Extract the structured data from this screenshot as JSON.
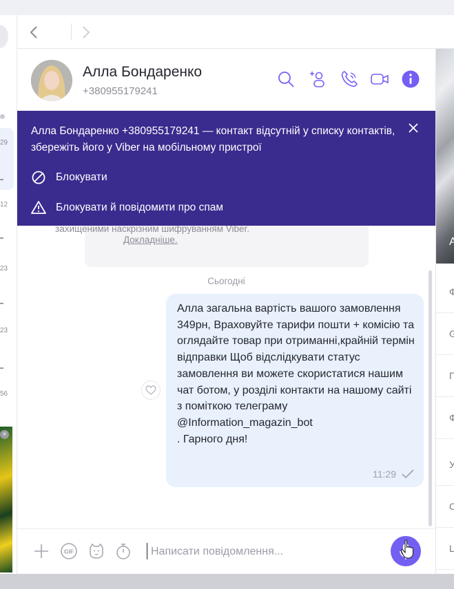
{
  "chat": {
    "contact_name": "Алла Бондаренко",
    "contact_phone": "+380955179241",
    "banner": {
      "text": "Алла Бондаренко +380955179241 — контакт відсутній у списку контактів, збережіть його у Viber на мобільному пристрої",
      "block_label": "Блокувати",
      "block_report_label": "Блокувати й повідомити про спам"
    },
    "history_notice": {
      "text": "захищеними наскрізним шифруванням Viber.",
      "link": "Докладніше."
    },
    "date_separator": "Сьогодні",
    "message": {
      "text": "Алла загальна вартість вашого замовлення 349рн, Враховуйте тарифи пошти + комісію  та оглядайте товар при отриманні,крайній термін відправки Щоб відслідкувати статус замовлення ви можете скористатися нашим чат ботом, у розділі контакти на нашому сайті з поміткою телеграму\n@Information_magazin_bot\n. Гарного дня!",
      "time": "11:29"
    },
    "composer": {
      "placeholder": "Написати повідомлення..."
    }
  },
  "left_list": {
    "times": [
      "29",
      "12",
      "23",
      "23",
      "56"
    ]
  },
  "right_panel": {
    "photo_letter": "А",
    "rows": [
      "Ф",
      "G",
      "Г",
      "Ф",
      "У",
      "С",
      "Ц"
    ]
  },
  "colors": {
    "banner": "#3a2b8e",
    "accent": "#7360f2",
    "bubble": "#e8f1fc"
  }
}
